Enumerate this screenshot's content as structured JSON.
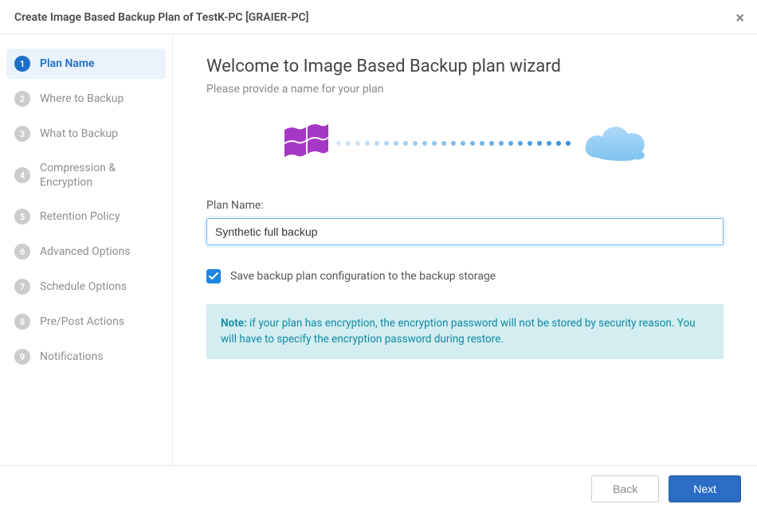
{
  "header": {
    "title": "Create Image Based Backup Plan of TestK-PC [GRAIER-PC]"
  },
  "sidebar": {
    "steps": [
      {
        "num": "1",
        "label": "Plan Name",
        "active": true
      },
      {
        "num": "2",
        "label": "Where to Backup",
        "active": false
      },
      {
        "num": "3",
        "label": "What to Backup",
        "active": false
      },
      {
        "num": "4",
        "label": "Compression & Encryption",
        "active": false
      },
      {
        "num": "5",
        "label": "Retention Policy",
        "active": false
      },
      {
        "num": "6",
        "label": "Advanced Options",
        "active": false
      },
      {
        "num": "7",
        "label": "Schedule Options",
        "active": false
      },
      {
        "num": "8",
        "label": "Pre/Post Actions",
        "active": false
      },
      {
        "num": "9",
        "label": "Notifications",
        "active": false
      }
    ]
  },
  "main": {
    "title": "Welcome to Image Based Backup plan wizard",
    "subtitle": "Please provide a name for your plan",
    "plan_name_label": "Plan Name:",
    "plan_name_value": "Synthetic full backup",
    "save_config_label": "Save backup plan configuration to the backup storage",
    "save_config_checked": true,
    "note_prefix": "Note:",
    "note_text": " if your plan has encryption, the encryption password will not be stored by security reason. You will have to specify the encryption password during restore."
  },
  "footer": {
    "back_label": "Back",
    "next_label": "Next"
  },
  "colors": {
    "accent": "#1f6fc9",
    "note_bg": "#d3edf1",
    "note_text": "#0f8ba3"
  }
}
